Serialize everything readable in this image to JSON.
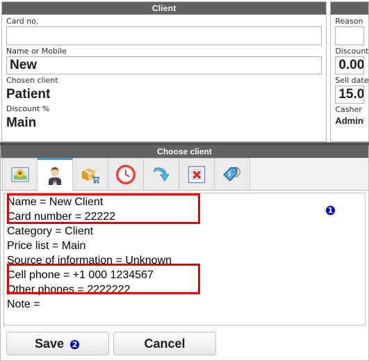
{
  "client_panel": {
    "title": "Client",
    "fields": [
      {
        "label": "Card no.",
        "value": "",
        "kind": "input"
      },
      {
        "label": "Name or Mobile",
        "value": "New",
        "kind": "input"
      },
      {
        "label": "Chosen client",
        "value": "Patient",
        "kind": "static"
      },
      {
        "label": "Discount %",
        "value": "Main",
        "kind": "static"
      }
    ]
  },
  "sale_panel": {
    "title": "",
    "fields": [
      {
        "label": "Reason",
        "value": "",
        "kind": "input"
      },
      {
        "label": "Discount",
        "value": "0.00",
        "kind": "input"
      },
      {
        "label": "Sell date",
        "value": "15.0",
        "kind": "input"
      },
      {
        "label": "Casher",
        "value": "Admini",
        "kind": "static_small"
      }
    ]
  },
  "chooser": {
    "title": "Choose client",
    "tabs": [
      {
        "icon": "picture-icon",
        "name": "tab-picture",
        "active": false
      },
      {
        "icon": "person-icon",
        "name": "tab-person",
        "active": true
      },
      {
        "icon": "box-cart-icon",
        "name": "tab-purchases",
        "active": false
      },
      {
        "icon": "clock-icon",
        "name": "tab-history",
        "active": false
      },
      {
        "icon": "arrow-down-icon",
        "name": "tab-transfer",
        "active": false
      },
      {
        "icon": "doc-delete-icon",
        "name": "tab-documents",
        "active": false
      },
      {
        "icon": "price-tag-icon",
        "name": "tab-pricing",
        "active": false
      }
    ],
    "details": [
      "Name = New Client",
      "Card number = 22222",
      "Category = Client",
      "Price list = Main",
      "Source of information = Unknown",
      "Cell phone = +1 000 1234567",
      "Other phones = 2222222",
      "Note ="
    ],
    "annotations": [
      {
        "label": "1",
        "name": "annotation-badge-1"
      },
      {
        "label": "2",
        "name": "annotation-badge-2"
      }
    ]
  },
  "buttons": {
    "save": "Save",
    "cancel": "Cancel"
  },
  "colors": {
    "header_bar": "#636363",
    "active_tab": "#2ba6df",
    "annotation_red": "#ef0000",
    "badge_blue": "#0000c8"
  }
}
